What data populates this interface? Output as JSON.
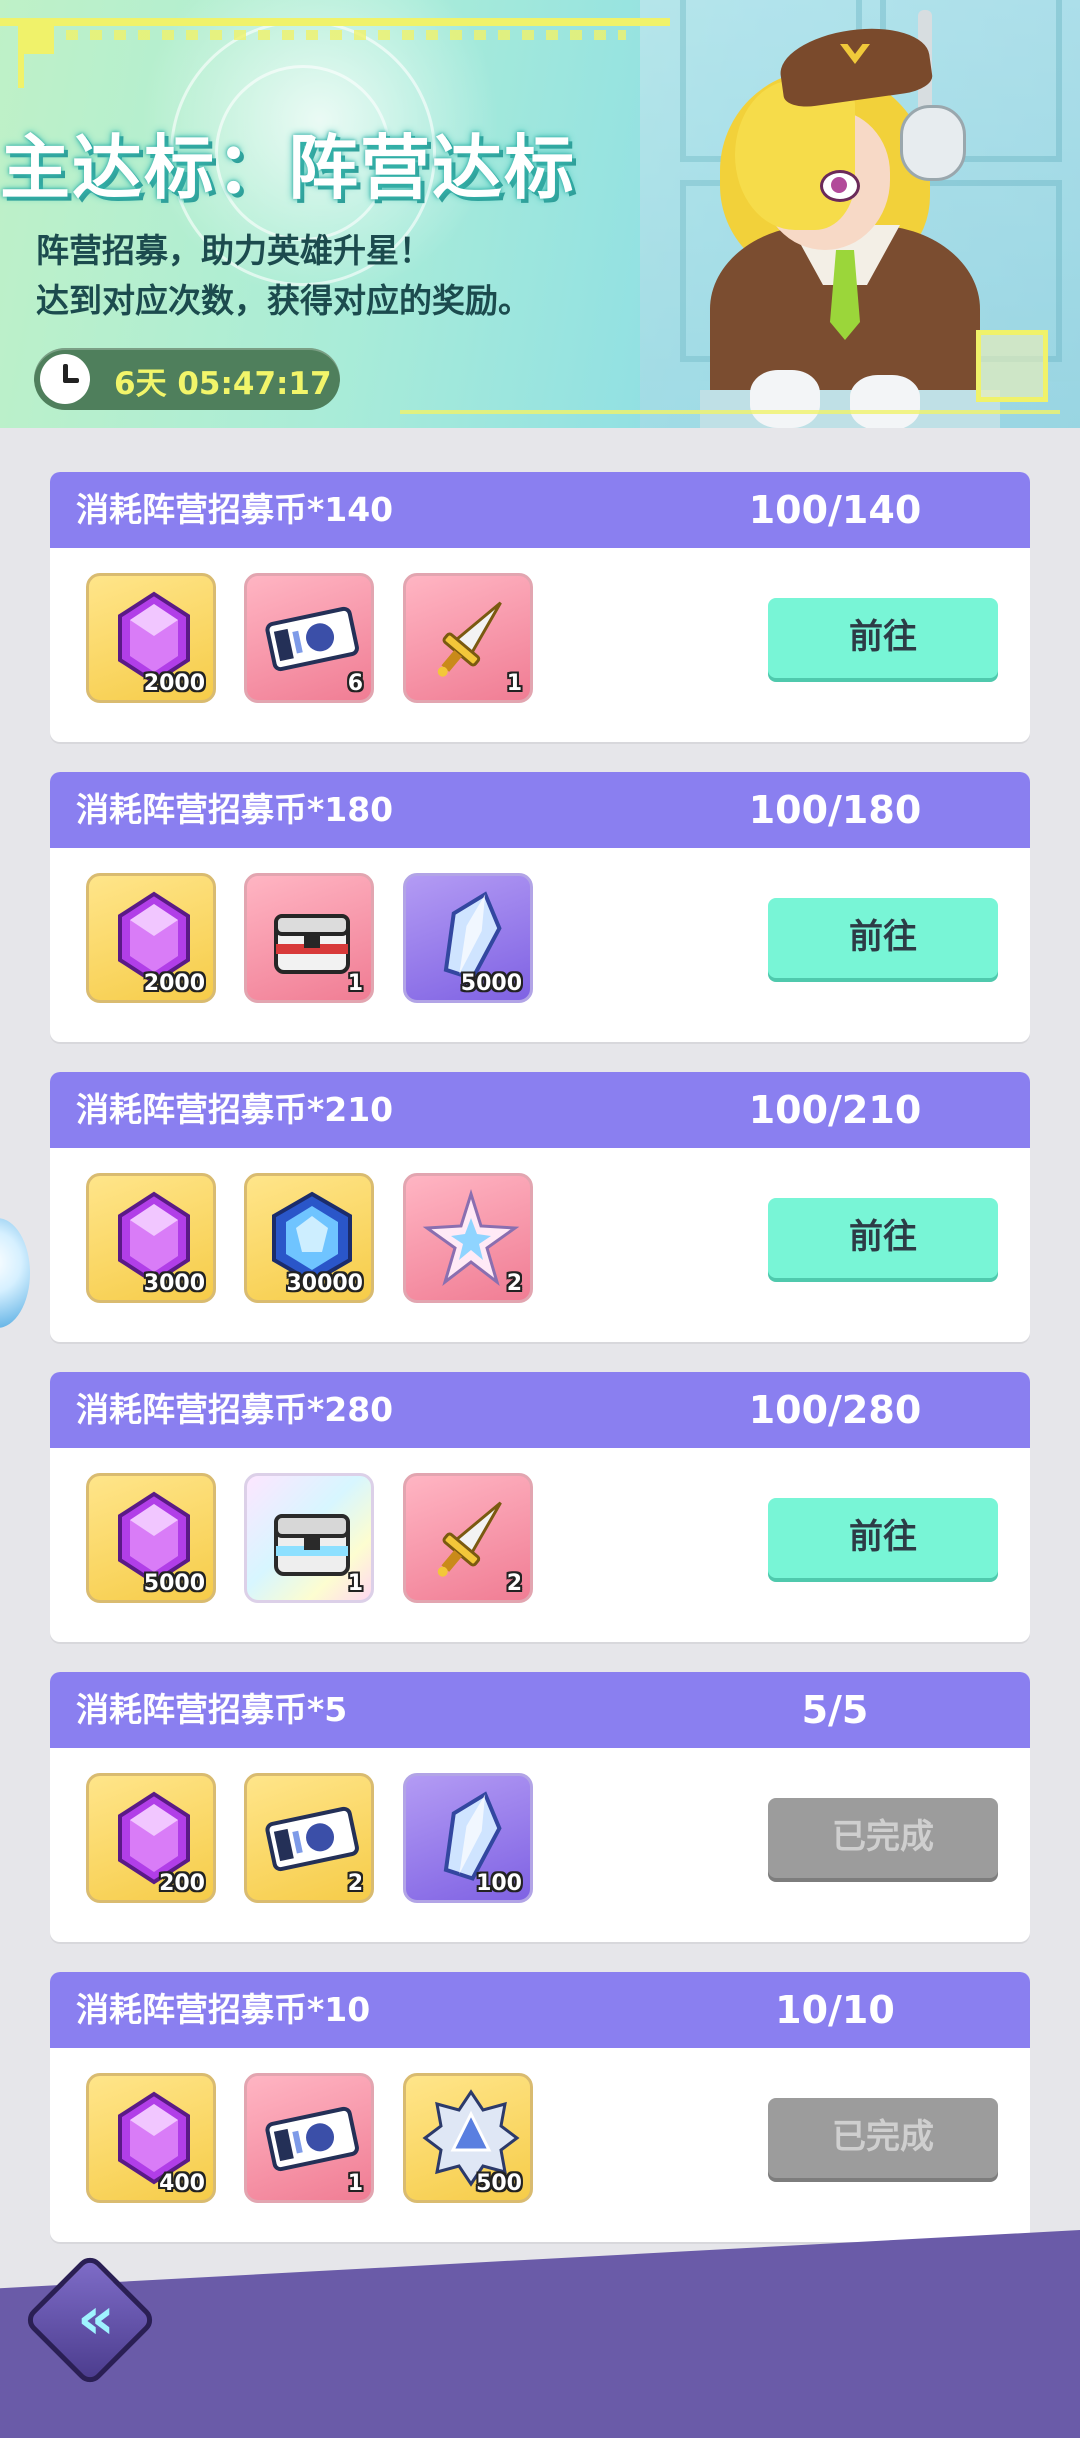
{
  "banner": {
    "title": "主达标：阵营达标",
    "desc_line1": "阵营招募，助力英雄升星！",
    "desc_line2": "达到对应次数，获得对应的奖励。",
    "timer": "6天 05:47:17"
  },
  "colors": {
    "header_purple": "#8a7ff0",
    "go_button": "#78f5d6",
    "done_button": "#9c9c9c",
    "timer_text": "#f2f56a"
  },
  "tasks": [
    {
      "title": "消耗阵营招募币*140",
      "progress": "100/140",
      "button": "前往",
      "rewards": [
        {
          "icon": "purple-gem-icon",
          "count": "2000"
        },
        {
          "icon": "recruit-ticket-icon",
          "count": "6"
        },
        {
          "icon": "golden-sword-icon",
          "count": "1"
        }
      ]
    },
    {
      "title": "消耗阵营招募币*180",
      "progress": "100/180",
      "button": "前往",
      "rewards": [
        {
          "icon": "purple-gem-icon",
          "count": "2000"
        },
        {
          "icon": "supply-chest-icon",
          "count": "1"
        },
        {
          "icon": "blue-crystal-icon",
          "count": "5000"
        }
      ]
    },
    {
      "title": "消耗阵营招募币*210",
      "progress": "100/210",
      "button": "前往",
      "rewards": [
        {
          "icon": "purple-gem-icon",
          "count": "3000"
        },
        {
          "icon": "hexagon-blue-gem-icon",
          "count": "30000"
        },
        {
          "icon": "star-shard-icon",
          "count": "2"
        }
      ]
    },
    {
      "title": "消耗阵营招募币*280",
      "progress": "100/280",
      "button": "前往",
      "rewards": [
        {
          "icon": "purple-gem-icon",
          "count": "5000"
        },
        {
          "icon": "rainbow-chest-icon",
          "count": "1"
        },
        {
          "icon": "golden-sword-icon",
          "count": "2"
        }
      ]
    },
    {
      "title": "消耗阵营招募币*5",
      "progress": "5/5",
      "button": "已完成",
      "rewards": [
        {
          "icon": "purple-gem-icon",
          "count": "200"
        },
        {
          "icon": "recruit-ticket-icon",
          "count": "2"
        },
        {
          "icon": "blue-crystal-icon",
          "count": "100"
        }
      ]
    },
    {
      "title": "消耗阵营招募币*10",
      "progress": "10/10",
      "button": "已完成",
      "rewards": [
        {
          "icon": "purple-gem-icon",
          "count": "400"
        },
        {
          "icon": "recruit-ticket-icon",
          "count": "1"
        },
        {
          "icon": "silver-star-badge-icon",
          "count": "500"
        }
      ]
    }
  ],
  "nav": {
    "back_icon": "double-chevron-left-icon",
    "back_label": "«"
  }
}
